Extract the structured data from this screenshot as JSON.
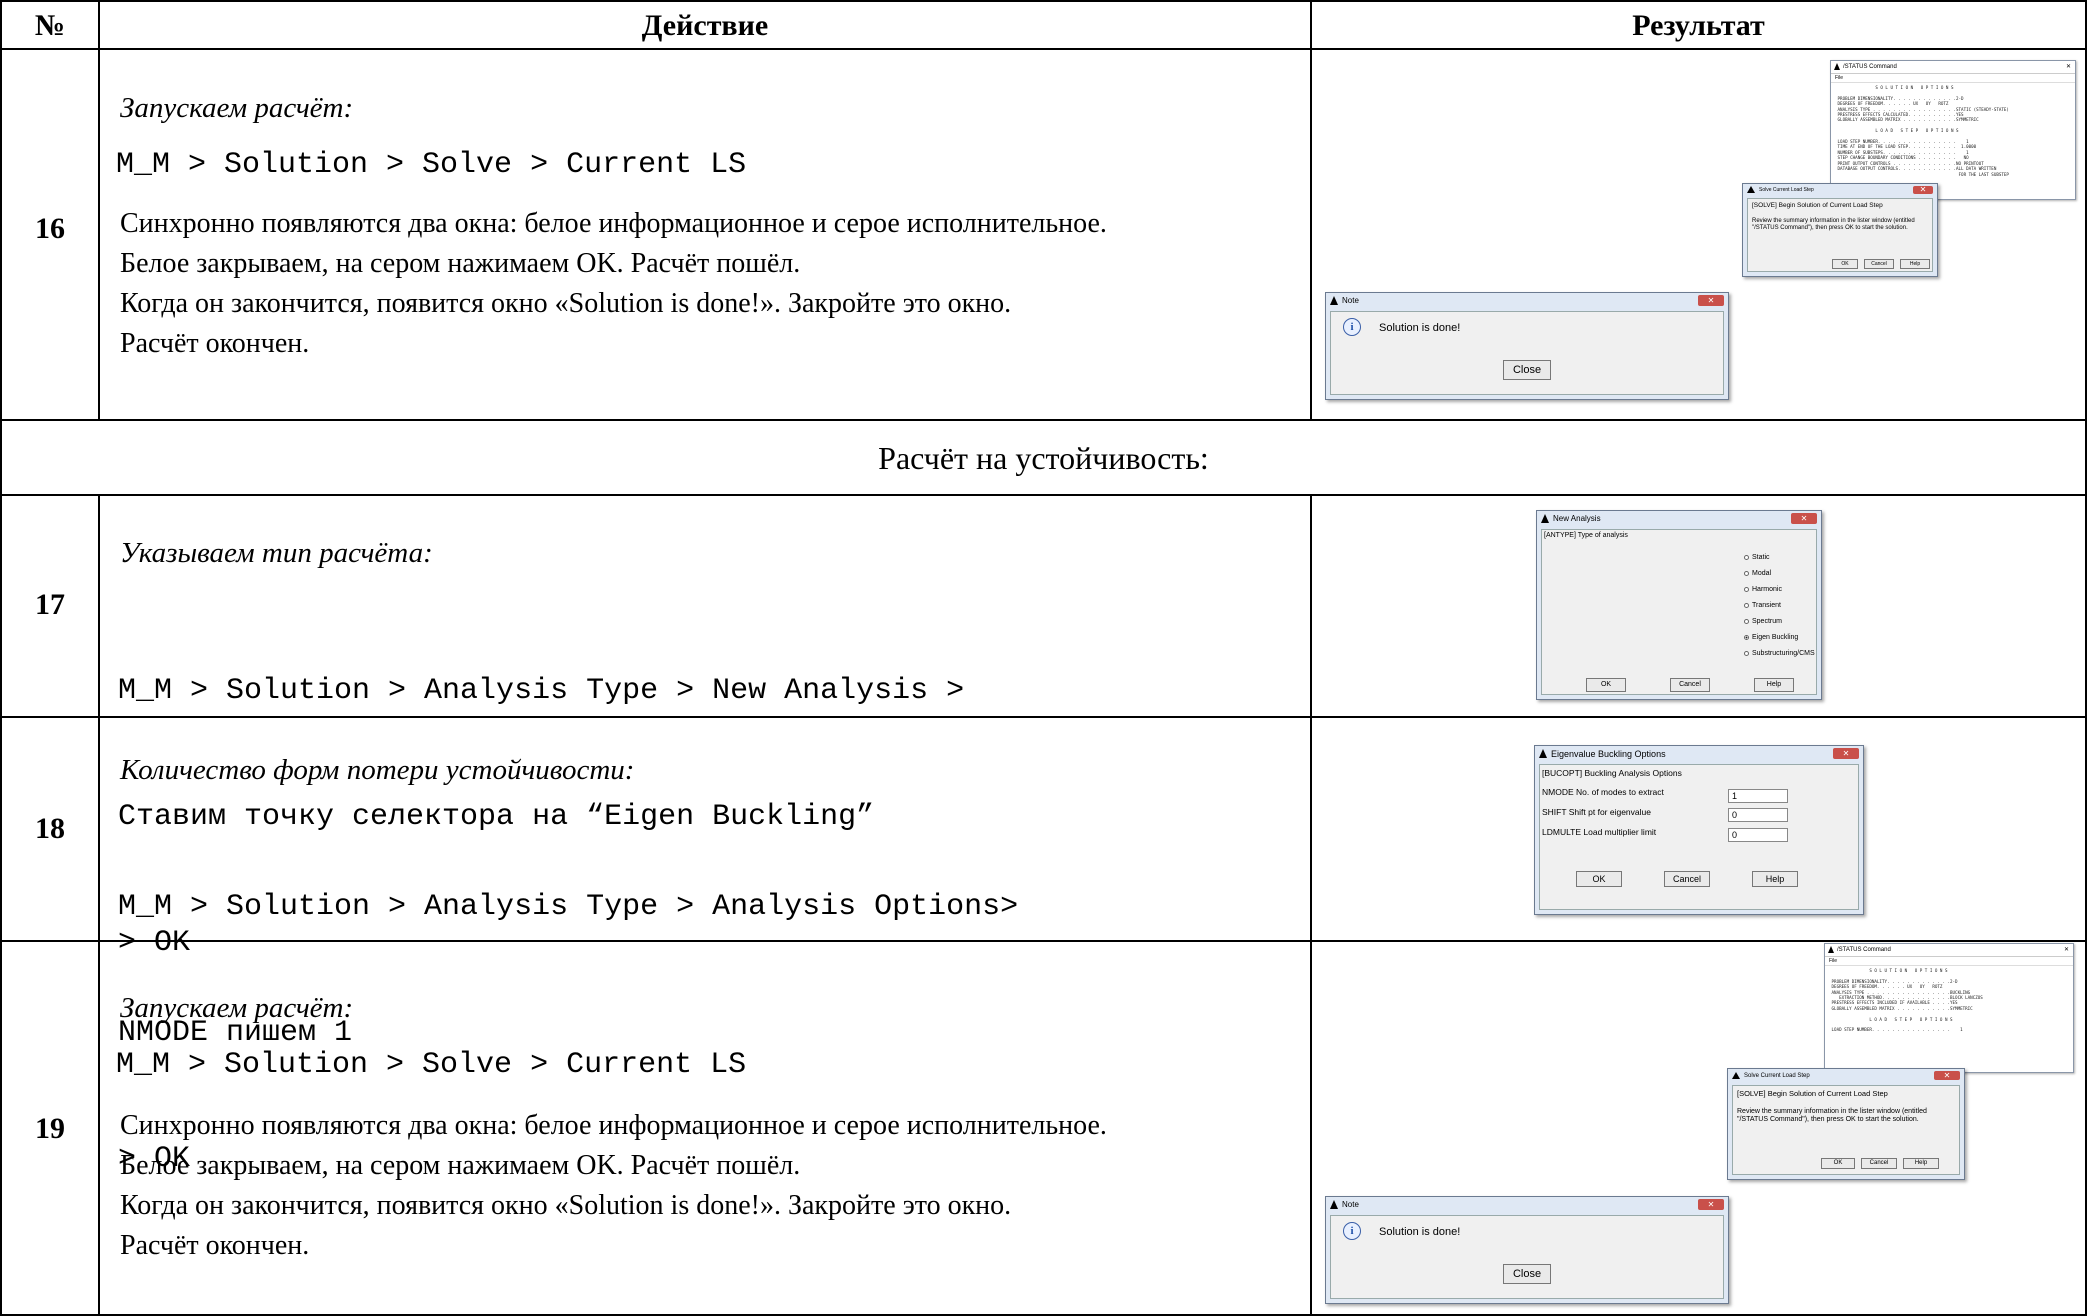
{
  "header": {
    "num": "№",
    "action": "Действие",
    "result": "Результат"
  },
  "section_title": "Расчёт на устойчивость:",
  "rows": [
    {
      "num": "16",
      "title": "Запускаем расчёт:",
      "path": "M_M > Solution > Solve > Current LS",
      "text": [
        "Синхронно появляются два окна: белое информационное и серое исполнительное.",
        "Белое закрываем, на сером нажимаем OK. Расчёт пошёл.",
        "Когда он закончится, появится окно «Solution is done!». Закройте это окно.",
        "Расчёт окончен."
      ]
    },
    {
      "num": "17",
      "title": "Указываем тип расчёта:",
      "path_lines": [
        "M_M > Solution > Analysis Type > New Analysis >",
        "Ставим точку селектора на “Eigen Buckling”",
        "> OK"
      ]
    },
    {
      "num": "18",
      "title": "Количество форм потери устойчивости:",
      "path_lines": [
        "M_M > Solution > Analysis Type > Analysis Options>",
        "NMODE пишем 1",
        "> OK"
      ]
    },
    {
      "num": "19",
      "title": "Запускаем расчёт:",
      "path": "M_M > Solution > Solve > Current LS",
      "text": [
        "Синхронно появляются два окна: белое информационное и серое исполнительное.",
        "Белое закрываем, на сером нажимаем OK. Расчёт пошёл.",
        "Когда он закончится, появится окно «Solution is done!». Закройте это окно.",
        "Расчёт окончен."
      ]
    }
  ],
  "windows": {
    "status": {
      "title": "/STATUS Command",
      "menu": "File",
      "text16": "                S O L U T I O N   O P T I O N S\n\n PROBLEM DIMENSIONALITY. . . . . . . . . . . . .2-D\n DEGREES OF FREEDOM. . . . . . UX   UY   ROTZ\n ANALYSIS TYPE . . . . . . . . . . . . . . . . .STATIC (STEADY-STATE)\n PRESTRESS EFFECTS CALCULATED. . . . . . . . . .YES\n GLOBALLY ASSEMBLED MATRIX . . . . . . . . . . .SYMMETRIC\n\n                L O A D   S T E P   O P T I O N S\n\n LOAD STEP NUMBER. . . . . . . . . . . . . . . .    1\n TIME AT END OF THE LOAD STEP. . . . . . . . . .  1.0000\n NUMBER OF SUBSTEPS. . . . . . . . . . . . . . .    1\n STEP CHANGE BOUNDARY CONDITIONS . . . . . . . .   NO\n PRINT OUTPUT CONTROLS . . . . . . . . . . . . .NO PRINTOUT\n DATABASE OUTPUT CONTROLS. . . . . . . . . . . .ALL DATA WRITTEN\n                                                 FOR THE LAST SUBSTEP",
      "text19": "                S O L U T I O N   O P T I O N S\n\n PROBLEM DIMENSIONALITY. . . . . . . . . . . . .2-D\n DEGREES OF FREEDOM. . . . . . UX   UY   ROTZ\n ANALYSIS TYPE . . . . . . . . . . . . . . . . .BUCKLING\n    EXTRACTION METHOD. . . . . . . . . . . . . .BLOCK LANCZOS\n PRESTRESS EFFECTS INCLUDED IF AVAILABLE . . . .YES\n GLOBALLY ASSEMBLED MATRIX . . . . . . . . . . .SYMMETRIC\n\n                L O A D   S T E P   O P T I O N S\n\n LOAD STEP NUMBER. . . . . . . . . . . . . . . .    1"
    },
    "solve": {
      "title": "Solve Current Load Step",
      "head": "[SOLVE] Begin Solution of Current Load Step",
      "body": "Review the summary information in the lister window (entitled \"/STATUS Command\"), then press OK to start the solution.",
      "ok": "OK",
      "cancel": "Cancel",
      "help": "Help"
    },
    "note": {
      "title": "Note",
      "message": "Solution is done!",
      "close": "Close"
    },
    "new_analysis": {
      "title": "New Analysis",
      "label": "[ANTYPE]  Type of analysis",
      "options": [
        "Static",
        "Modal",
        "Harmonic",
        "Transient",
        "Spectrum",
        "Eigen Buckling",
        "Substructuring/CMS"
      ],
      "selected": "Eigen Buckling",
      "ok": "OK",
      "cancel": "Cancel",
      "help": "Help"
    },
    "eigen": {
      "title": "Eigenvalue Buckling Options",
      "label": "[BUCOPT]  Buckling Analysis Options",
      "nmode_label": "NMODE   No. of modes to extract",
      "nmode_value": "1",
      "shift_label": "SHIFT   Shift pt for eigenvalue",
      "shift_value": "0",
      "ldmulte_label": "LDMULTE  Load multiplier limit",
      "ldmulte_value": "0",
      "ok": "OK",
      "cancel": "Cancel",
      "help": "Help"
    }
  }
}
